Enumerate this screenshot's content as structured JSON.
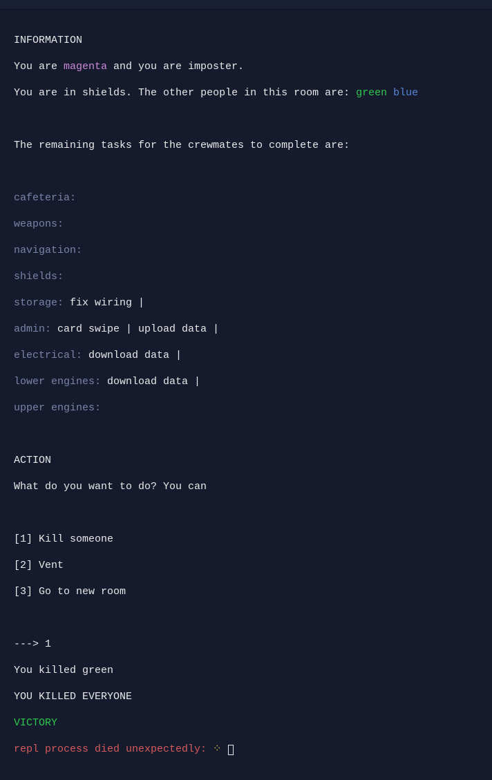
{
  "info": {
    "heading": "INFORMATION",
    "you_are_prefix": "You are ",
    "player_color": "magenta",
    "you_are_suffix": " and you are imposter.",
    "location_prefix": "You are in ",
    "location": "shields",
    "location_mid": ". The other people in this room are: ",
    "others": [
      {
        "name": "green",
        "class": "green"
      },
      {
        "name": "blue",
        "class": "blue"
      }
    ],
    "tasks_intro": "The remaining tasks for the crewmates to complete are:"
  },
  "rooms": [
    {
      "name": "cafeteria:",
      "tasks": ""
    },
    {
      "name": "weapons:",
      "tasks": ""
    },
    {
      "name": "navigation:",
      "tasks": ""
    },
    {
      "name": "shields:",
      "tasks": ""
    },
    {
      "name": "storage:",
      "tasks": " fix wiring |"
    },
    {
      "name": "admin:",
      "tasks": " card swipe | upload data |"
    },
    {
      "name": "electrical:",
      "tasks": " download data |"
    },
    {
      "name": "lower engines:",
      "tasks": " download data |"
    },
    {
      "name": "upper engines:",
      "tasks": ""
    }
  ],
  "action": {
    "heading": "ACTION",
    "prompt": "What do you want to do? You can",
    "options": [
      "[1] Kill someone",
      "[2] Vent",
      "[3] Go to new room"
    ],
    "input_prefix": "---> ",
    "input_value": "1",
    "result1": "You killed green",
    "result2": "YOU KILLED EVERYONE",
    "victory": "VICTORY",
    "error_prefix": "repl process died unexpectedly: ",
    "error_glyph": "⁘"
  }
}
